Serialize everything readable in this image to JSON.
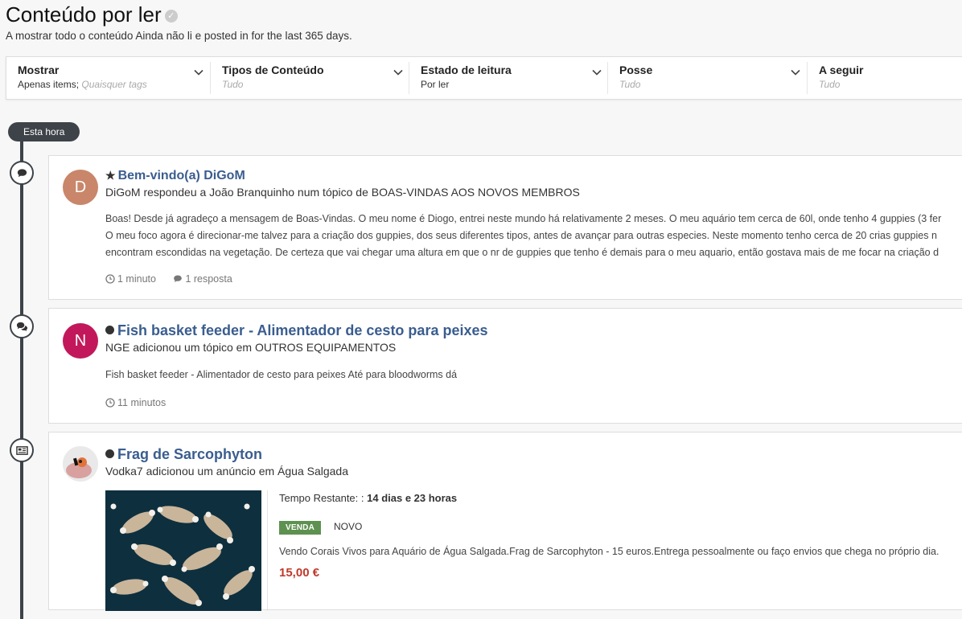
{
  "header": {
    "title": "Conteúdo por ler",
    "subtitle": "A mostrar todo o conteúdo Ainda não li e posted in for the last 365 days."
  },
  "filters": [
    {
      "title": "Mostrar",
      "value": "Apenas items;",
      "placeholder": "Quaisquer tags"
    },
    {
      "title": "Tipos de Conteúdo",
      "value": "",
      "placeholder": "Tudo"
    },
    {
      "title": "Estado de leitura",
      "value": "Por ler",
      "placeholder": ""
    },
    {
      "title": "Posse",
      "value": "",
      "placeholder": "Tudo"
    },
    {
      "title": "A seguir",
      "value": "",
      "placeholder": "Tudo"
    }
  ],
  "timeline": {
    "hour_label": "Esta hora"
  },
  "items": [
    {
      "icon": "comment-icon",
      "avatar_letter": "D",
      "avatar_color": "#c9866a",
      "title": "Bem-vindo(a) DiGoM",
      "meta": "DiGoM respondeu a João Branquinho num tópico de BOAS-VINDAS AOS NOVOS MEMBROS",
      "body_lines": [
        "Boas! Desde já agradeço a mensagem de Boas-Vindas. O meu nome é Diogo, entrei neste mundo há relativamente 2 meses. O meu aquário tem cerca de 60l, onde tenho 4 guppies (3 fer",
        "O meu foco agora é direcionar-me talvez para a criação dos guppies, dos seus diferentes tipos, antes de avançar para outras especies. Neste momento tenho cerca de 20 crias guppies n",
        "encontram escondidas na vegetação. De certeza que vai chegar uma altura em que o nr de guppies que tenho é demais para o meu aquario, então gostava mais de me focar na criação d"
      ],
      "time": "1 minuto",
      "replies": "1 resposta"
    },
    {
      "icon": "comments-icon",
      "avatar_letter": "N",
      "avatar_color": "#c2185b",
      "title": "Fish basket feeder - Alimentador de cesto para peixes",
      "meta": "NGE adicionou um tópico em OUTROS EQUIPAMENTOS",
      "body": "Fish basket feeder - Alimentador de cesto para peixes Até para bloodworms dá",
      "time": "11 minutos"
    },
    {
      "icon": "classifieds-icon",
      "title": "Frag de Sarcophyton",
      "meta": "Vodka7 adicionou um anúncio em Água Salgada",
      "remaining_label": "Tempo Restante: :",
      "remaining_value": "14 dias e 23 horas",
      "badge": "VENDA",
      "condition": "NOVO",
      "description": "Vendo Corais Vivos para Aquário de Água Salgada.Frag de Sarcophyton - 15 euros.Entrega pessoalmente ou faço envios que chega no próprio dia.",
      "price": "15,00 €"
    }
  ]
}
